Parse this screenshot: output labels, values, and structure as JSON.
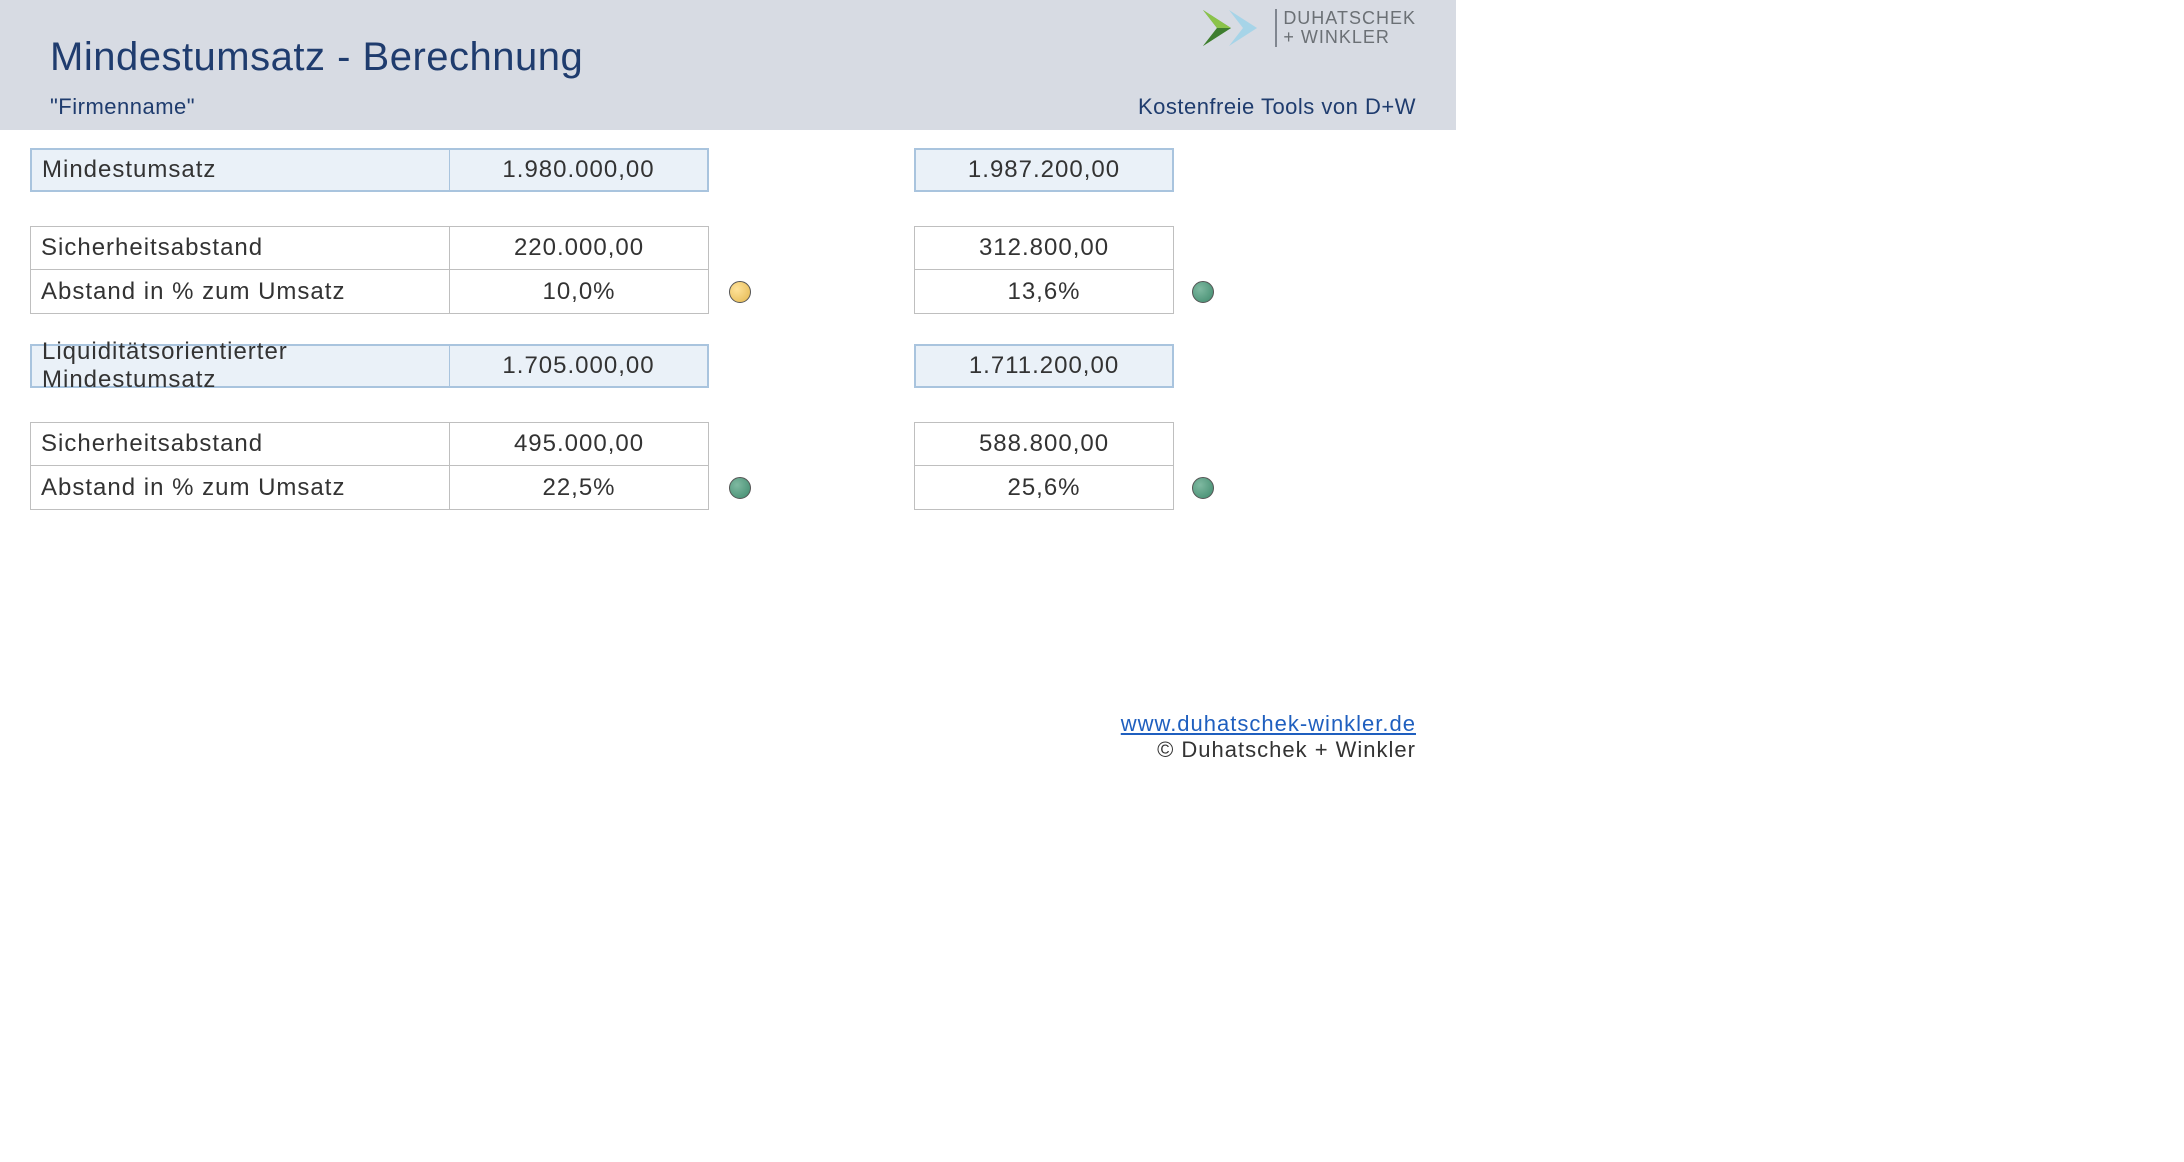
{
  "header": {
    "title": "Mindestumsatz - Berechnung",
    "company_placeholder": "\"Firmenname\"",
    "tagline": "Kostenfreie Tools von D+W",
    "logo_line1": "DUHATSCHEK",
    "logo_line2": "+ WINKLER"
  },
  "sections": [
    {
      "heading": "Mindestumsatz",
      "valueA": "1.980.000,00",
      "valueB": "1.987.200,00",
      "rows": [
        {
          "label": "Sicherheitsabstand",
          "valA": "220.000,00",
          "valB": "312.800,00",
          "dotA": null,
          "dotB": null
        },
        {
          "label": "Abstand in % zum Umsatz",
          "valA": "10,0%",
          "valB": "13,6%",
          "dotA": "yellow",
          "dotB": "green"
        }
      ]
    },
    {
      "heading": "Liquiditätsorientierter Mindestumsatz",
      "valueA": "1.705.000,00",
      "valueB": "1.711.200,00",
      "rows": [
        {
          "label": "Sicherheitsabstand",
          "valA": "495.000,00",
          "valB": "588.800,00",
          "dotA": null,
          "dotB": null
        },
        {
          "label": "Abstand in % zum Umsatz",
          "valA": "22,5%",
          "valB": "25,6%",
          "dotA": "green",
          "dotB": "green"
        }
      ]
    }
  ],
  "footer": {
    "link_text": "www.duhatschek-winkler.de",
    "copyright": "© Duhatschek + Winkler"
  }
}
